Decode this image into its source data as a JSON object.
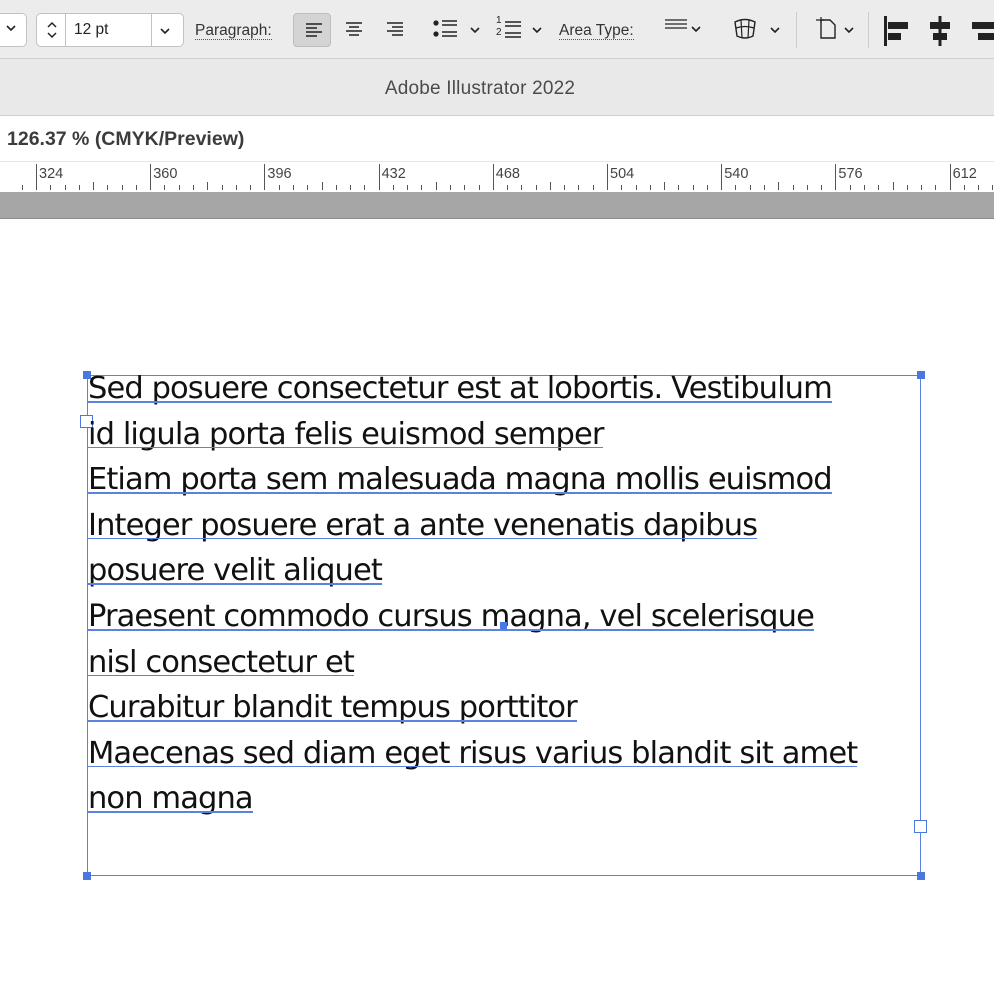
{
  "control_bar": {
    "font_size_value": "12 pt",
    "paragraph_label": "Paragraph:",
    "area_type_label": "Area Type:",
    "numbered_list_digits": [
      "1",
      "2"
    ]
  },
  "window": {
    "title": "Adobe Illustrator 2022"
  },
  "document": {
    "tab_label": "126.37 % (CMYK/Preview)"
  },
  "ruler": {
    "labels": [
      "324",
      "360",
      "396",
      "432",
      "468",
      "504",
      "540",
      "576",
      "612"
    ]
  },
  "text_frame": {
    "lines": [
      "Sed posuere consectetur est at lobortis. Vestibulum",
      "id ligula porta felis euismod semper",
      "Etiam porta sem malesuada magna mollis euismod",
      "Integer posuere erat a ante venenatis dapibus",
      "posuere velit aliquet",
      "Praesent commodo cursus magna, vel scelerisque",
      "nisl consectetur et",
      "Curabitur blandit tempus porttitor",
      "Maecenas sed diam eget risus varius blandit sit amet",
      "non magna"
    ]
  },
  "colors": {
    "selection": "#4a78de",
    "toolbar_bg": "#ececec",
    "pasteboard_band": "#a6a6a6"
  },
  "icons": [
    "chevron-down-icon",
    "stepper-icon",
    "align-left-icon",
    "align-center-icon",
    "align-right-icon",
    "bullet-list-icon",
    "numbered-list-icon",
    "area-type-icon",
    "warp-icon",
    "transform-icon",
    "align-objects-left-icon",
    "align-objects-center-icon"
  ]
}
